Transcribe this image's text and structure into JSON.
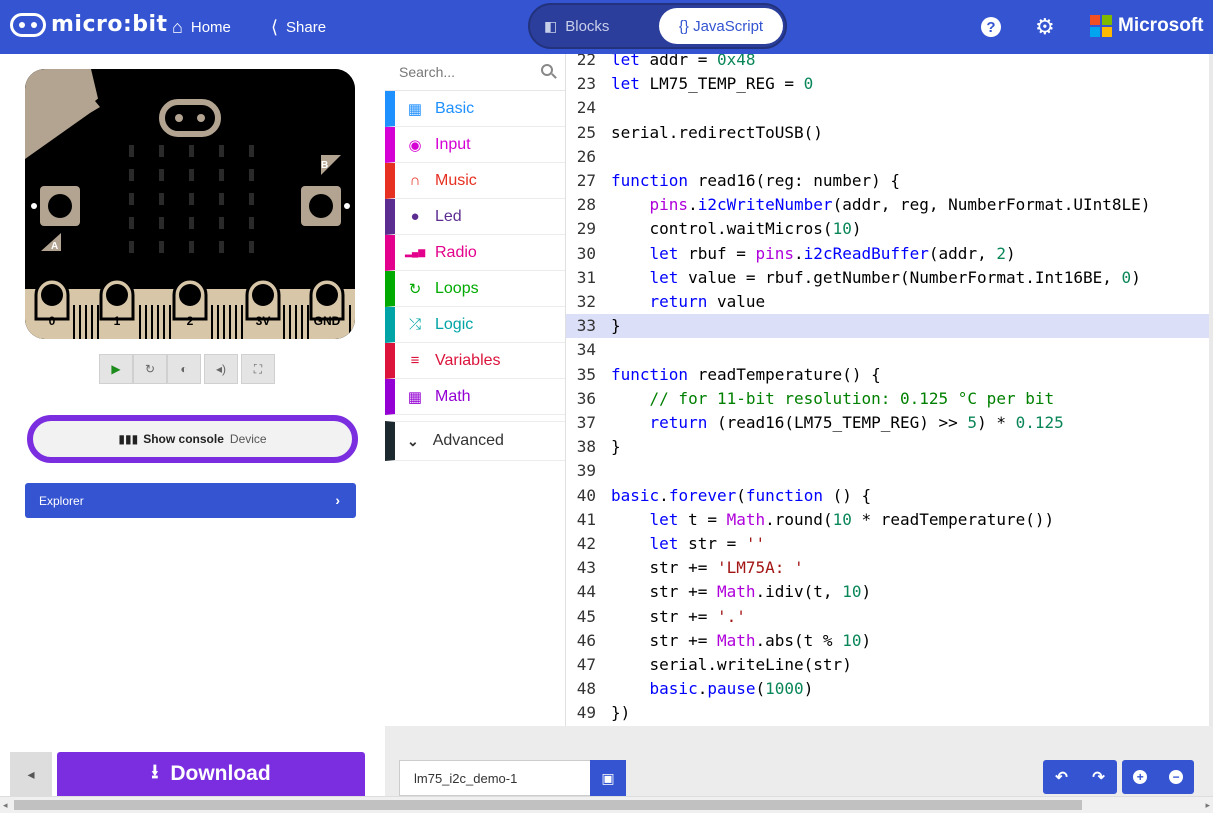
{
  "header": {
    "logo_text": "micro:bit",
    "home_label": "Home",
    "share_label": "Share",
    "blocks_label": "Blocks",
    "javascript_label": "{} JavaScript",
    "microsoft_label": "Microsoft",
    "colors": {
      "bar": "#3454d1",
      "ms_red": "#f25022",
      "ms_green": "#7fba00",
      "ms_blue": "#00a4ef",
      "ms_yellow": "#ffb900"
    }
  },
  "simulator": {
    "pins": [
      "0",
      "1",
      "2",
      "3V",
      "GND"
    ],
    "button_a": "A",
    "button_b": "B",
    "controls": [
      "play-icon",
      "restart-icon",
      "slowmo-icon",
      "mute-icon",
      "fullscreen-icon"
    ],
    "console_label": "Show console",
    "console_sub": "Device",
    "explorer_label": "Explorer"
  },
  "toolbox": {
    "search_placeholder": "Search...",
    "categories": [
      {
        "label": "Basic",
        "color": "#1e90ff",
        "icon": "grid-icon"
      },
      {
        "label": "Input",
        "color": "#d400d4",
        "icon": "target-icon"
      },
      {
        "label": "Music",
        "color": "#e63022",
        "icon": "headphones-icon"
      },
      {
        "label": "Led",
        "color": "#5c2d91",
        "icon": "toggle-icon"
      },
      {
        "label": "Radio",
        "color": "#e3008c",
        "icon": "signal-icon"
      },
      {
        "label": "Loops",
        "color": "#00aa00",
        "icon": "refresh-icon"
      },
      {
        "label": "Logic",
        "color": "#00a4a6",
        "icon": "shuffle-icon"
      },
      {
        "label": "Variables",
        "color": "#dc143c",
        "icon": "list-icon"
      },
      {
        "label": "Math",
        "color": "#9400d3",
        "icon": "calculator-icon"
      }
    ],
    "advanced_label": "Advanced"
  },
  "editor": {
    "lines": [
      {
        "n": "22",
        "t": "let addr = 0x48"
      },
      {
        "n": "23",
        "t": "let LM75_TEMP_REG = 0"
      },
      {
        "n": "24",
        "t": ""
      },
      {
        "n": "25",
        "t": "serial.redirectToUSB()"
      },
      {
        "n": "26",
        "t": ""
      },
      {
        "n": "27",
        "t": "function read16(reg: number) {"
      },
      {
        "n": "28",
        "t": "    pins.i2cWriteNumber(addr, reg, NumberFormat.UInt8LE)"
      },
      {
        "n": "29",
        "t": "    control.waitMicros(10)"
      },
      {
        "n": "30",
        "t": "    let rbuf = pins.i2cReadBuffer(addr, 2)"
      },
      {
        "n": "31",
        "t": "    let value = rbuf.getNumber(NumberFormat.Int16BE, 0)"
      },
      {
        "n": "32",
        "t": "    return value"
      },
      {
        "n": "33",
        "t": "}"
      },
      {
        "n": "34",
        "t": ""
      },
      {
        "n": "35",
        "t": "function readTemperature() {"
      },
      {
        "n": "36",
        "t": "    // for 11-bit resolution: 0.125 °C per bit"
      },
      {
        "n": "37",
        "t": "    return (read16(LM75_TEMP_REG) >> 5) * 0.125"
      },
      {
        "n": "38",
        "t": "}"
      },
      {
        "n": "39",
        "t": ""
      },
      {
        "n": "40",
        "t": "basic.forever(function () {"
      },
      {
        "n": "41",
        "t": "    let t = Math.round(10 * readTemperature())"
      },
      {
        "n": "42",
        "t": "    let str = ''"
      },
      {
        "n": "43",
        "t": "    str += 'LM75A: '"
      },
      {
        "n": "44",
        "t": "    str += Math.idiv(t, 10)"
      },
      {
        "n": "45",
        "t": "    str += '.'"
      },
      {
        "n": "46",
        "t": "    str += Math.abs(t % 10)"
      },
      {
        "n": "47",
        "t": "    serial.writeLine(str)"
      },
      {
        "n": "48",
        "t": "    basic.pause(1000)"
      },
      {
        "n": "49",
        "t": "})"
      }
    ],
    "highlighted_line": "33"
  },
  "bottom": {
    "download_label": "Download",
    "filename_value": "lm75_i2c_demo-1"
  }
}
